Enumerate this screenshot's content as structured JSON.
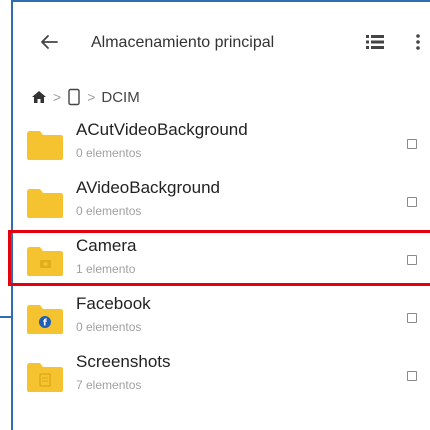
{
  "toolbar": {
    "back_icon": "arrow-left-icon",
    "title": "Almacenamiento principal",
    "view_icon": "list-view-icon",
    "more_icon": "more-vertical-icon"
  },
  "breadcrumb": {
    "home_icon": "home-icon",
    "device_icon": "phone-icon",
    "separator": ">",
    "current": "DCIM"
  },
  "folders": [
    {
      "name": "ACutVideoBackground",
      "count": "0 elementos",
      "icon": "folder-icon"
    },
    {
      "name": "AVideoBackground",
      "count": "0 elementos",
      "icon": "folder-icon"
    },
    {
      "name": "Camera",
      "count": "1 elemento",
      "icon": "camera-folder-icon"
    },
    {
      "name": "Facebook",
      "count": "0 elementos",
      "icon": "facebook-folder-icon"
    },
    {
      "name": "Screenshots",
      "count": "7 elementos",
      "icon": "screenshots-folder-icon"
    }
  ],
  "colors": {
    "folder": "#f5c230",
    "folder_dark": "#e2ad1a",
    "highlight": "#e4000f",
    "frame": "#2f6db2",
    "facebook_badge": "#1f5fb8"
  }
}
